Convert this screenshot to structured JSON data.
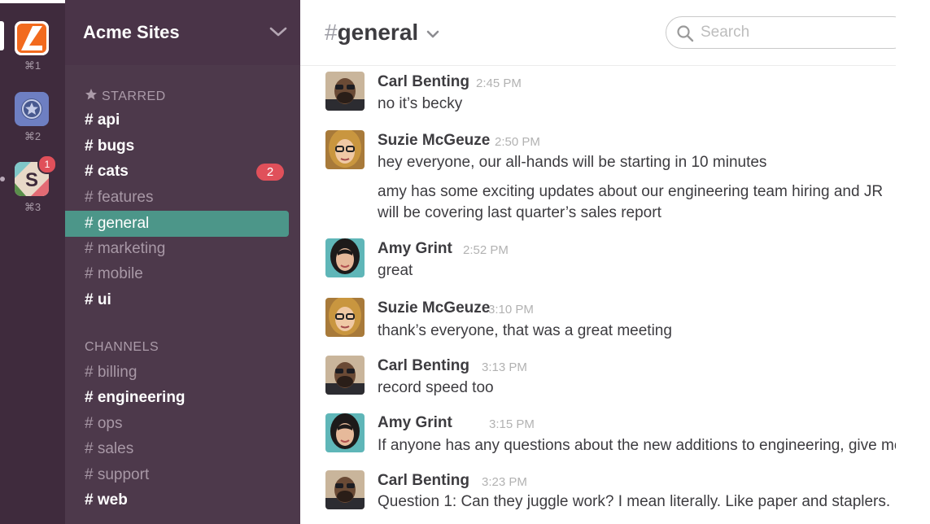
{
  "team_rail": {
    "teams": [
      {
        "name": "acme-logo",
        "shortcut": "⌘1"
      },
      {
        "name": "star-team",
        "shortcut": "⌘2"
      },
      {
        "name": "slack-team",
        "shortcut": "⌘3",
        "badge": "1"
      }
    ]
  },
  "sidebar": {
    "team_name": "Acme Sites",
    "starred_label": "STARRED",
    "starred": [
      {
        "name": "# api"
      },
      {
        "name": "# bugs"
      },
      {
        "name": "# cats",
        "badge": "2"
      },
      {
        "name": "# features"
      },
      {
        "name": "# general"
      },
      {
        "name": "# marketing"
      },
      {
        "name": "# mobile"
      },
      {
        "name": "# ui"
      }
    ],
    "channels_label": "CHANNELS",
    "channels": [
      {
        "name": "# billing"
      },
      {
        "name": "# engineering"
      },
      {
        "name": "# ops"
      },
      {
        "name": "# sales"
      },
      {
        "name": "# support"
      },
      {
        "name": "# web"
      }
    ]
  },
  "header": {
    "hash": "#",
    "channel": "general",
    "search_placeholder": "Search"
  },
  "messages": [
    {
      "author": "Carl Benting",
      "time": "2:45 PM",
      "lines": [
        "no it’s becky"
      ]
    },
    {
      "author": "Suzie McGeuze",
      "time": "2:50 PM",
      "lines": [
        "hey everyone, our all-hands will be starting in 10 minutes",
        "amy has some exciting updates about our engineering team hiring and JR",
        "will be covering last quarter’s sales report"
      ]
    },
    {
      "author": "Amy Grint",
      "time": "2:52 PM",
      "lines": [
        "great"
      ]
    },
    {
      "author": "Suzie McGeuze",
      "time": "3:10 PM",
      "lines": [
        "thank’s everyone, that was a great meeting"
      ]
    },
    {
      "author": "Carl Benting",
      "time": "3:13 PM",
      "lines": [
        "record speed too"
      ]
    },
    {
      "author": "Amy Grint",
      "time": "3:15 PM",
      "lines": [
        "If anyone has any questions about the new additions to engineering, give me"
      ]
    },
    {
      "author": "Carl Benting",
      "time": "3:23 PM",
      "lines": [
        "Question 1: Can they juggle work? I mean literally. Like paper and staplers."
      ]
    }
  ],
  "colors": {
    "rail": "#3f2b3d",
    "sidebar": "#4d394b",
    "active_channel": "#4c9689",
    "badge": "#e0505a"
  }
}
